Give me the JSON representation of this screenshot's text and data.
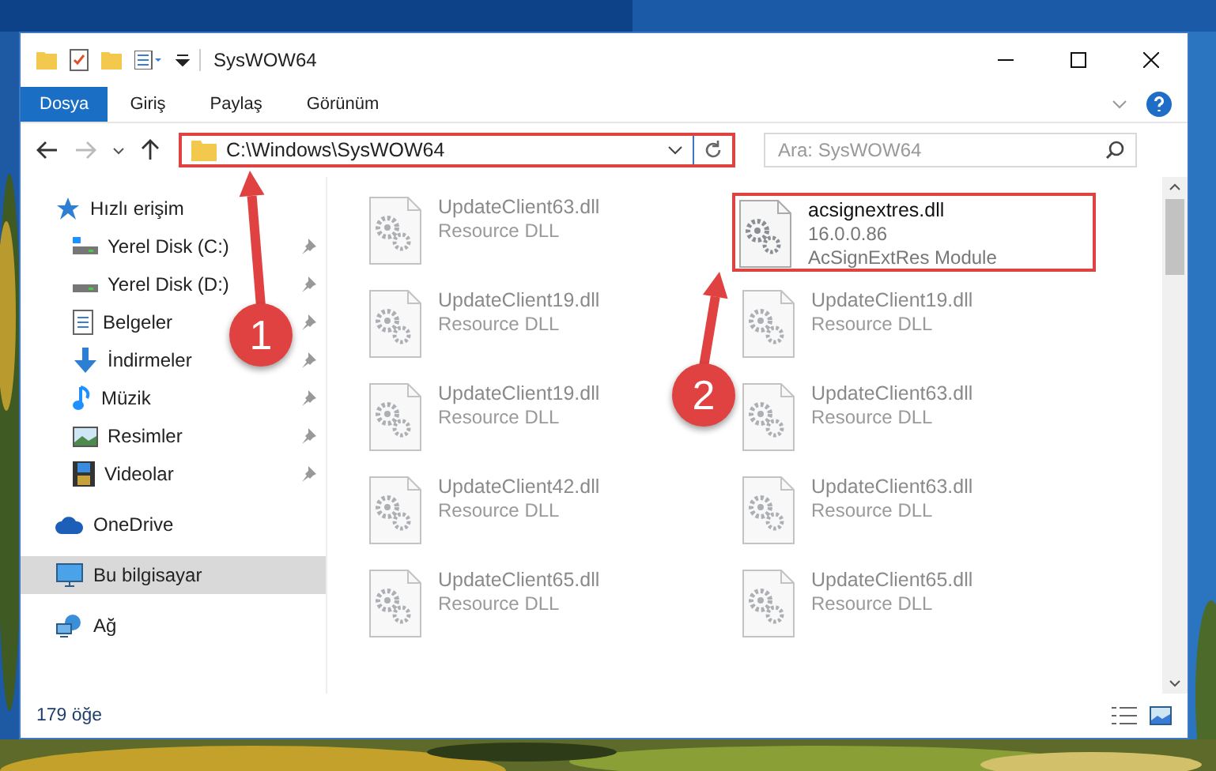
{
  "window": {
    "title": "SysWOW64"
  },
  "ribbon_tabs": [
    {
      "label": "Dosya",
      "selected": true
    },
    {
      "label": "Giriş",
      "selected": false
    },
    {
      "label": "Paylaş",
      "selected": false
    },
    {
      "label": "Görünüm",
      "selected": false
    }
  ],
  "address_bar": {
    "value": "C:\\Windows\\SysWOW64",
    "highlighted": true
  },
  "search": {
    "placeholder": "Ara: SysWOW64"
  },
  "nav": [
    {
      "label": "Hızlı erişim",
      "selected": false,
      "children": [
        {
          "label": "Yerel Disk (C:)",
          "pinned": true,
          "selected": false
        },
        {
          "label": "Yerel Disk (D:)",
          "pinned": true,
          "selected": false
        },
        {
          "label": "Belgeler",
          "pinned": true,
          "selected": false
        },
        {
          "label": "İndirmeler",
          "pinned": true,
          "selected": false
        },
        {
          "label": "Müzik",
          "pinned": true,
          "selected": false
        },
        {
          "label": "Resimler",
          "pinned": true,
          "selected": false
        },
        {
          "label": "Videolar",
          "pinned": true,
          "selected": false
        }
      ]
    },
    {
      "label": "OneDrive",
      "selected": false
    },
    {
      "label": "Bu bilgisayar",
      "selected": true
    },
    {
      "label": "Ağ",
      "selected": false
    }
  ],
  "files": [
    {
      "name": "UpdateClient63.dll",
      "details": [
        "Resource DLL"
      ],
      "blurred": true,
      "highlighted": false
    },
    {
      "name": "acsignextres.dll",
      "details": [
        "16.0.0.86",
        "AcSignExtRes Module"
      ],
      "blurred": false,
      "highlighted": true
    },
    {
      "name": "UpdateClient19.dll",
      "details": [
        "Resource DLL"
      ],
      "blurred": true,
      "highlighted": false
    },
    {
      "name": "UpdateClient19.dll",
      "details": [
        "Resource DLL"
      ],
      "blurred": true,
      "highlighted": false
    },
    {
      "name": "UpdateClient19.dll",
      "details": [
        "Resource DLL"
      ],
      "blurred": true,
      "highlighted": false
    },
    {
      "name": "UpdateClient63.dll",
      "details": [
        "Resource DLL"
      ],
      "blurred": true,
      "highlighted": false
    },
    {
      "name": "UpdateClient42.dll",
      "details": [
        "Resource DLL"
      ],
      "blurred": true,
      "highlighted": false
    },
    {
      "name": "UpdateClient63.dll",
      "details": [
        "Resource DLL"
      ],
      "blurred": true,
      "highlighted": false
    },
    {
      "name": "UpdateClient65.dll",
      "details": [
        "Resource DLL"
      ],
      "blurred": true,
      "highlighted": false
    },
    {
      "name": "UpdateClient65.dll",
      "details": [
        "Resource DLL"
      ],
      "blurred": true,
      "highlighted": false
    }
  ],
  "status_bar": {
    "item_count": "179 öğe"
  },
  "annotations": [
    {
      "label": "1"
    },
    {
      "label": "2"
    }
  ]
}
